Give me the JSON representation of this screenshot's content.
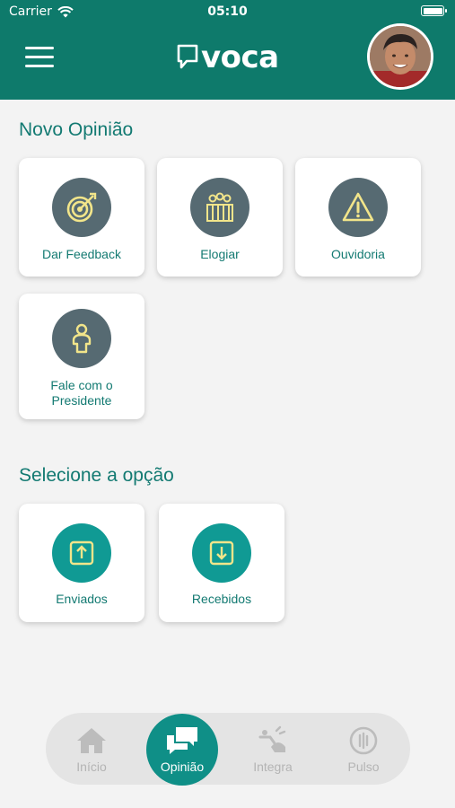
{
  "status_bar": {
    "carrier": "Carrier",
    "time": "05:10"
  },
  "app_bar": {
    "logo_text": "voca"
  },
  "novo": {
    "title": "Novo Opinião",
    "cards": [
      {
        "label": "Dar Feedback",
        "icon": "target-icon"
      },
      {
        "label": "Elogiar",
        "icon": "applause-icon"
      },
      {
        "label": "Ouvidoria",
        "icon": "warning-icon"
      },
      {
        "label_line1": "Fale com o",
        "label_line2": "Presidente",
        "icon": "person-icon"
      }
    ]
  },
  "selecione": {
    "title": "Selecione a opção",
    "cards": [
      {
        "label": "Enviados",
        "icon": "arrow-up-box-icon"
      },
      {
        "label": "Recebidos",
        "icon": "arrow-down-box-icon"
      }
    ]
  },
  "bottom_nav": {
    "items": [
      {
        "label": "Início",
        "icon": "home-icon",
        "active": false
      },
      {
        "label": "Opinião",
        "icon": "chat-bubbles-icon",
        "active": true
      },
      {
        "label": "Integra",
        "icon": "integra-icon",
        "active": false
      },
      {
        "label": "Pulso",
        "icon": "pulse-icon",
        "active": false
      }
    ]
  },
  "colors": {
    "primary": "#0e7a6b",
    "accent": "#109a94",
    "card_icon_bg": "#566a72",
    "icon_yellow": "#f2e58a",
    "text_teal": "#137a72"
  }
}
